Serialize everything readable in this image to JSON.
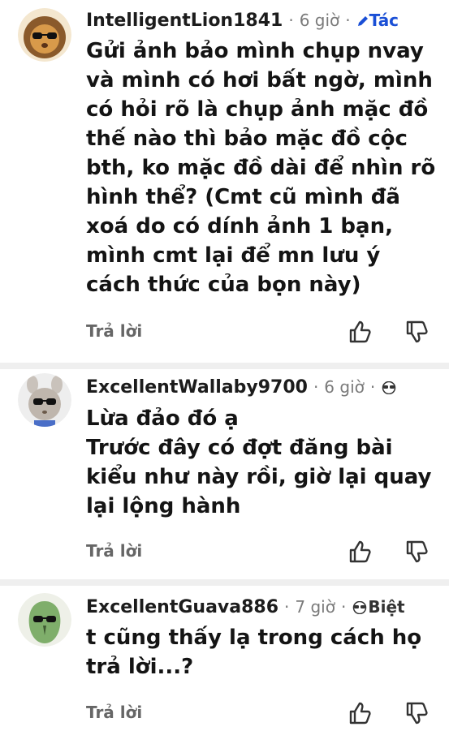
{
  "comments": [
    {
      "author": "IntelligentLion1841",
      "time": "6 giờ",
      "flair": "Tác",
      "body_lines": [
        "Gửi ảnh bảo mình chụp nvay",
        "và mình có hơi bất ngờ, mình",
        "có hỏi rõ là chụp ảnh mặc đồ",
        "thế nào thì bảo mặc đồ cộc",
        "bth, ko mặc đồ dài để nhìn rõ",
        "hình thể? (Cmt cũ mình đã",
        "xoá do có dính ảnh 1 bạn,",
        "mình cmt lại để mn lưu ý",
        "cách thức của bọn này)"
      ],
      "reply_label": "Trả lời",
      "avatar_icon": "lion-avatar-icon"
    },
    {
      "author": "ExcellentWallaby9700",
      "time": "6 giờ",
      "flair": "",
      "body_lines": [
        "Lừa đảo đó ạ",
        "Trước đây có đợt đăng bài",
        "kiểu như này rồi, giờ lại quay",
        "lại lộng hành"
      ],
      "reply_label": "Trả lời",
      "avatar_icon": "wallaby-avatar-icon"
    },
    {
      "author": "ExcellentGuava886",
      "time": "7 giờ",
      "flair": "Biệt",
      "body_lines": [
        "t cũng thấy lạ trong cách họ",
        "trả lời...?"
      ],
      "reply_label": "Trả lời",
      "avatar_icon": "guava-avatar-icon"
    }
  ],
  "separator": "·",
  "colors": {
    "flair_blue": "#1a4fd6",
    "meta_gray": "#7a7a7a",
    "divider": "#efefef"
  }
}
